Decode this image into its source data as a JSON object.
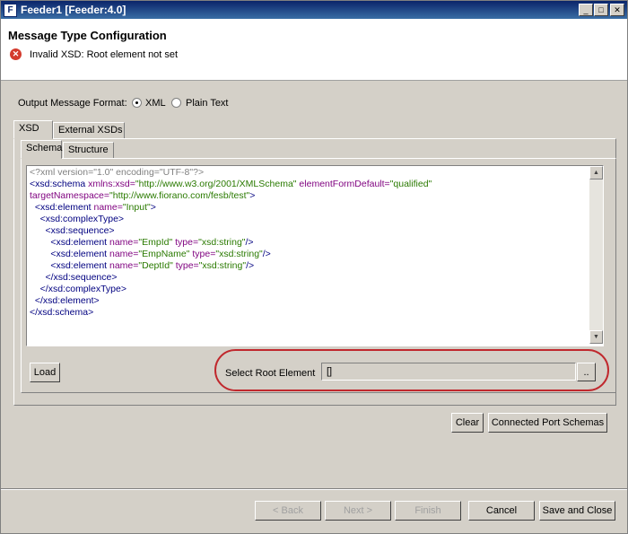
{
  "window": {
    "title": "Feeder1 [Feeder:4.0]",
    "app_icon": "F"
  },
  "window_controls": {
    "minimize": "_",
    "maximize": "□",
    "close": "✕"
  },
  "header": {
    "title": "Message Type Configuration",
    "error_message": "Invalid XSD: Root element not set",
    "error_glyph": "✕",
    "error_color": "#d43b2e"
  },
  "output_format": {
    "label": "Output Message Format:",
    "options": [
      "XML",
      "Plain Text"
    ],
    "selected": "XML"
  },
  "outer_tabs": [
    "XSD",
    "External XSDs"
  ],
  "inner_tabs": [
    "Schema",
    "Structure"
  ],
  "editor": {
    "lines": [
      {
        "parts": [
          {
            "t": "<?xml version=\"1.0\" encoding=\"UTF-8\"?>",
            "c": "gray"
          }
        ]
      },
      {
        "parts": [
          {
            "t": "<xsd:schema ",
            "c": "navy"
          },
          {
            "t": "xmlns:xsd=",
            "c": "purple"
          },
          {
            "t": "\"http://www.w3.org/2001/XMLSchema\"",
            "c": "green"
          },
          {
            "t": " elementFormDefault=",
            "c": "purple"
          },
          {
            "t": "\"qualified\"",
            "c": "green"
          }
        ]
      },
      {
        "parts": [
          {
            "t": "targetNamespace=",
            "c": "purple"
          },
          {
            "t": "\"http://www.fiorano.com/fesb/test\"",
            "c": "green"
          },
          {
            "t": ">",
            "c": "navy"
          }
        ]
      },
      {
        "parts": [
          {
            "t": "  <xsd:element ",
            "c": "navy"
          },
          {
            "t": "name=",
            "c": "purple"
          },
          {
            "t": "\"Input\"",
            "c": "green"
          },
          {
            "t": ">",
            "c": "navy"
          }
        ]
      },
      {
        "parts": [
          {
            "t": "    <xsd:complexType>",
            "c": "navy"
          }
        ]
      },
      {
        "parts": [
          {
            "t": "      <xsd:sequence>",
            "c": "navy"
          }
        ]
      },
      {
        "parts": [
          {
            "t": "        <xsd:element ",
            "c": "navy"
          },
          {
            "t": "name=",
            "c": "purple"
          },
          {
            "t": "\"EmpId\"",
            "c": "green"
          },
          {
            "t": " type=",
            "c": "purple"
          },
          {
            "t": "\"xsd:string\"",
            "c": "green"
          },
          {
            "t": "/>",
            "c": "navy"
          }
        ]
      },
      {
        "parts": [
          {
            "t": "        <xsd:element ",
            "c": "navy"
          },
          {
            "t": "name=",
            "c": "purple"
          },
          {
            "t": "\"EmpName\"",
            "c": "green"
          },
          {
            "t": " type=",
            "c": "purple"
          },
          {
            "t": "\"xsd:string\"",
            "c": "green"
          },
          {
            "t": "/>",
            "c": "navy"
          }
        ]
      },
      {
        "parts": [
          {
            "t": "        <xsd:element ",
            "c": "navy"
          },
          {
            "t": "name=",
            "c": "purple"
          },
          {
            "t": "\"DeptId\"",
            "c": "green"
          },
          {
            "t": " type=",
            "c": "purple"
          },
          {
            "t": "\"xsd:string\"",
            "c": "green"
          },
          {
            "t": "/>",
            "c": "navy"
          }
        ]
      },
      {
        "parts": [
          {
            "t": "      </xsd:sequence>",
            "c": "navy"
          }
        ]
      },
      {
        "parts": [
          {
            "t": "    </xsd:complexType>",
            "c": "navy"
          }
        ]
      },
      {
        "parts": [
          {
            "t": "  </xsd:element>",
            "c": "navy"
          }
        ]
      },
      {
        "parts": [
          {
            "t": "</xsd:schema>",
            "c": "navy"
          }
        ]
      }
    ],
    "scroll_up": "▲",
    "scroll_down": "▼"
  },
  "load_button": "Load",
  "root_element": {
    "label": "Select Root Element",
    "value": "[]",
    "browse_label": ".."
  },
  "actions": {
    "clear": "Clear",
    "connected_port_schemas": "Connected Port Schemas"
  },
  "footer": {
    "back": "< Back",
    "next": "Next >",
    "finish": "Finish",
    "cancel": "Cancel",
    "save_and_close": "Save and Close"
  }
}
